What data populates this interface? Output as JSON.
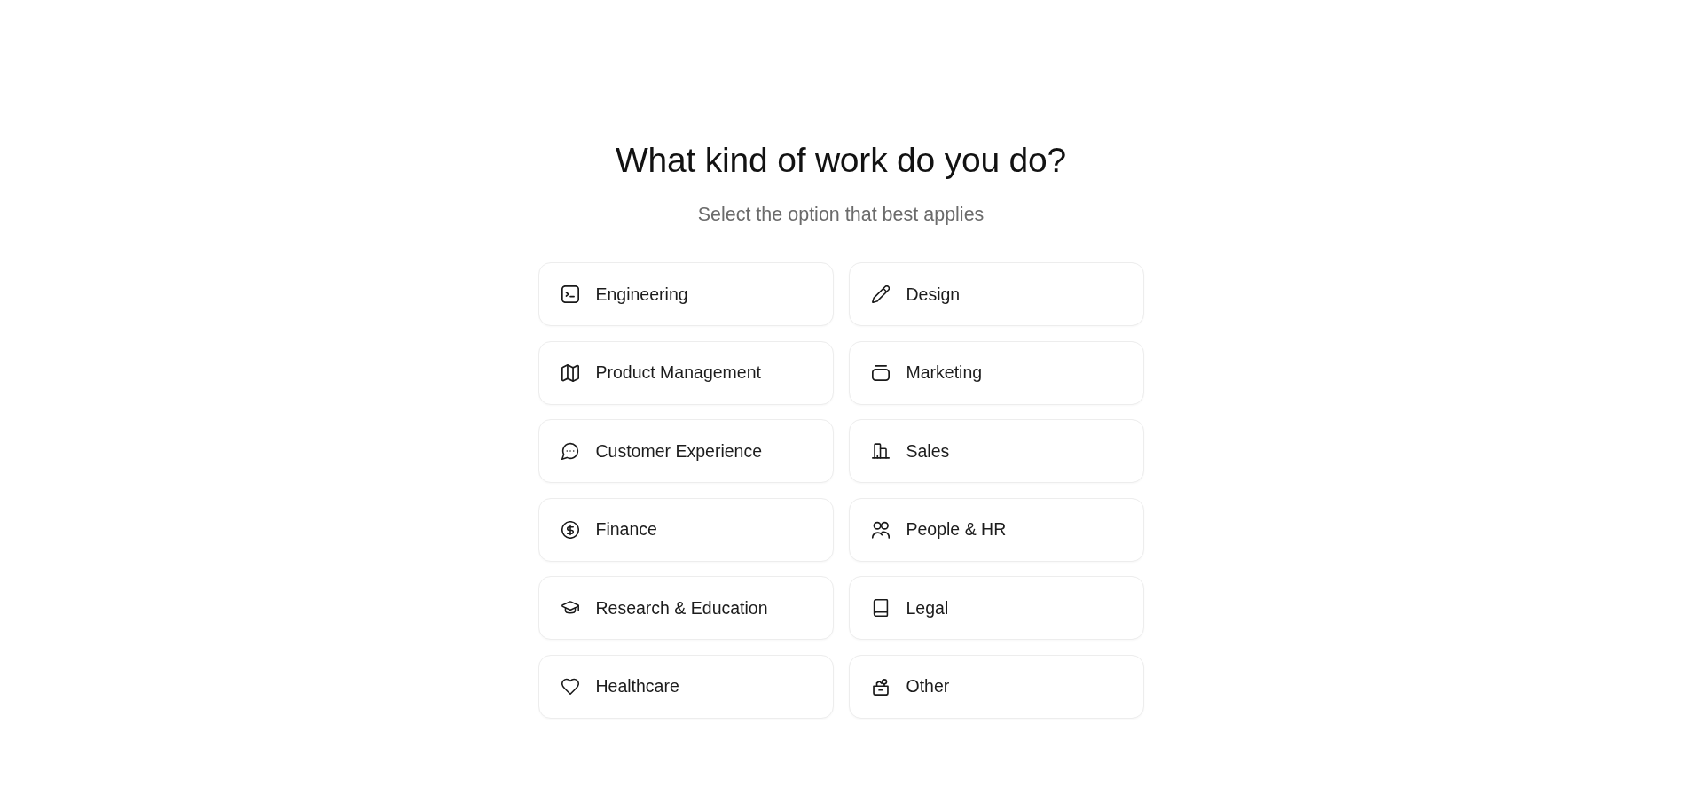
{
  "heading": {
    "title": "What kind of work do you do?",
    "subtitle": "Select the option that best applies"
  },
  "options": [
    {
      "label": "Engineering",
      "selected": false
    },
    {
      "label": "Design",
      "selected": false
    },
    {
      "label": "Product Management",
      "selected": false
    },
    {
      "label": "Marketing",
      "selected": false
    },
    {
      "label": "Customer Experience",
      "selected": false
    },
    {
      "label": "Sales",
      "selected": false
    },
    {
      "label": "Finance",
      "selected": false
    },
    {
      "label": "People & HR",
      "selected": false
    },
    {
      "label": "Research & Education",
      "selected": false
    },
    {
      "label": "Legal",
      "selected": false
    },
    {
      "label": "Healthcare",
      "selected": false
    },
    {
      "label": "Other",
      "selected": false
    }
  ]
}
